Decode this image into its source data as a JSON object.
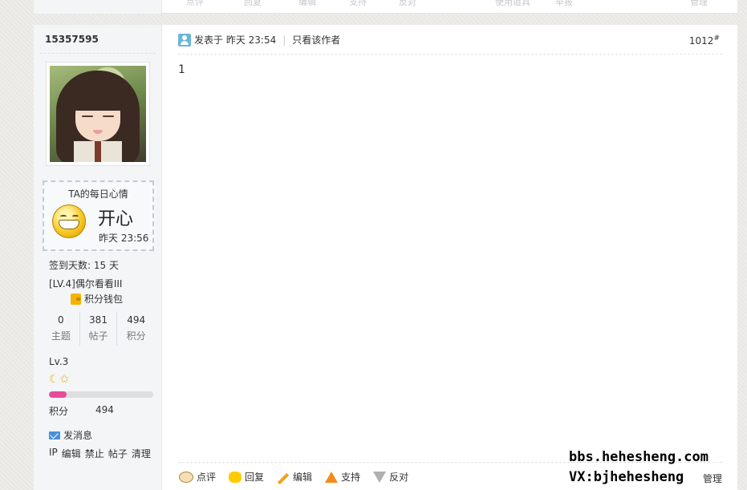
{
  "previous_post": {
    "actions_faded": [
      "点评",
      "回复",
      "编辑",
      "支持",
      "反对"
    ],
    "right_faded": [
      "使用道具",
      "举报",
      "管理"
    ]
  },
  "post": {
    "author": {
      "username": "15357595",
      "mood": {
        "title": "TA的每日心情",
        "word": "开心",
        "time": "昨天 23:56"
      },
      "checkin_days": "签到天数: 15 天",
      "rank": "[LV.4]偶尔看看III",
      "wallet": "积分钱包",
      "stats": [
        {
          "num": "0",
          "label": "主题"
        },
        {
          "num": "381",
          "label": "帖子"
        },
        {
          "num": "494",
          "label": "积分"
        }
      ],
      "level": "Lv.3",
      "level_icons": "☾✩",
      "progress_percent": 17,
      "score_label": "积分",
      "score_value": "494",
      "send_message": "发消息",
      "admin_links": [
        "IP",
        "编辑",
        "禁止",
        "帖子",
        "清理"
      ]
    },
    "header": {
      "posted": "发表于 昨天 23:54",
      "only_author": "只看该作者",
      "floor": "1012",
      "floor_mark": "#"
    },
    "body": "1",
    "actions": [
      {
        "icon": "comment-icon",
        "label": "点评"
      },
      {
        "icon": "reply-icon",
        "label": "回复"
      },
      {
        "icon": "edit-icon",
        "label": "编辑"
      },
      {
        "icon": "support-icon",
        "label": "支持"
      },
      {
        "icon": "oppose-icon",
        "label": "反对"
      }
    ],
    "manage": "管理"
  },
  "watermark": {
    "line1": "bbs.hehesheng.com",
    "line2": "VX:bjhehesheng"
  }
}
